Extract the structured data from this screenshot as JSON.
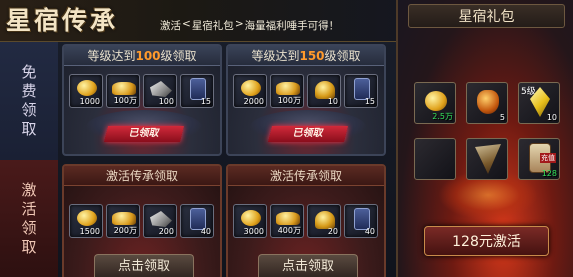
{
  "header": {
    "title": "星宿传承",
    "breadcrumb": [
      "激活",
      "<",
      "星宿礼包",
      ">",
      "海量福利唾手可得！"
    ]
  },
  "side": {
    "free_label": "免费领取",
    "activate_label": "激活领取"
  },
  "cards": [
    {
      "header_prefix": "等级达到",
      "level": "100",
      "header_suffix": "级领取",
      "items": [
        {
          "icon": "gold-coin-icon",
          "qty": "1000"
        },
        {
          "icon": "gold-ingot-icon",
          "qty": "100万"
        },
        {
          "icon": "silver-stone-icon",
          "qty": "100"
        },
        {
          "icon": "blue-scroll-icon",
          "qty": "15"
        }
      ],
      "status_label": "已领取"
    },
    {
      "header_prefix": "等级达到",
      "level": "150",
      "header_suffix": "级领取",
      "items": [
        {
          "icon": "gold-coin-icon",
          "qty": "2000"
        },
        {
          "icon": "gold-ingot-icon",
          "qty": "100万"
        },
        {
          "icon": "gold-helmet-icon",
          "qty": "10"
        },
        {
          "icon": "blue-scroll-icon",
          "qty": "15"
        }
      ],
      "status_label": "已领取"
    },
    {
      "header": "激活传承领取",
      "items": [
        {
          "icon": "gold-coin-icon",
          "qty": "1500"
        },
        {
          "icon": "gold-ingot-icon",
          "qty": "200万"
        },
        {
          "icon": "silver-stone-icon",
          "qty": "200"
        },
        {
          "icon": "blue-scroll-icon",
          "qty": "40"
        }
      ],
      "button_label": "点击领取"
    },
    {
      "header": "激活传承领取",
      "items": [
        {
          "icon": "gold-coin-icon",
          "qty": "3000"
        },
        {
          "icon": "gold-ingot-icon",
          "qty": "400万"
        },
        {
          "icon": "gold-helmet-icon",
          "qty": "20"
        },
        {
          "icon": "blue-scroll-icon",
          "qty": "40"
        }
      ],
      "button_label": "点击领取"
    }
  ],
  "gift_panel": {
    "title": "星宿礼包",
    "items": [
      {
        "icon": "gold-coin-icon",
        "qty": "2.5万"
      },
      {
        "icon": "orange-pouch-icon",
        "qty": "5"
      },
      {
        "icon": "yellow-crystal-icon",
        "qty": "10",
        "top_label": "5级"
      },
      {
        "icon": "empty-slot",
        "qty": ""
      },
      {
        "icon": "feather-fan-icon",
        "qty": ""
      },
      {
        "icon": "recharge-scroll-icon",
        "qty": "128",
        "tag": "充值"
      }
    ],
    "buy_label": "128元激活"
  }
}
